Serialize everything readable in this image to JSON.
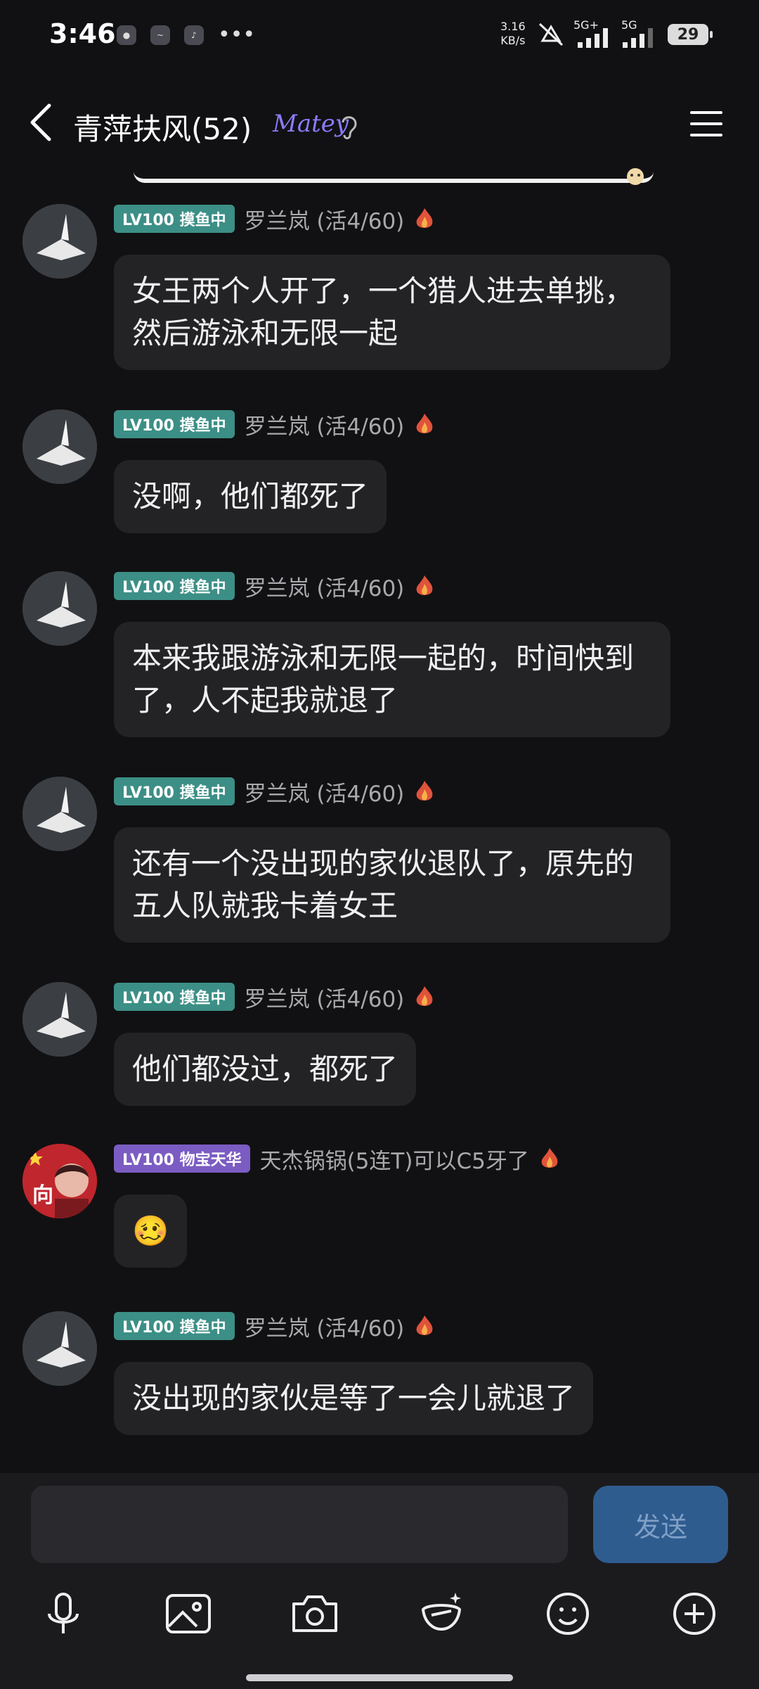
{
  "status_bar": {
    "time": "3:46",
    "net_speed": "3.16",
    "net_unit": "KB/s",
    "sig1": "5G+",
    "sig2": "5G",
    "battery": "29"
  },
  "header": {
    "title": "青萍扶风(52)",
    "badge_text": "Matey"
  },
  "messages": [
    {
      "badge": "LV100 摸鱼中",
      "name": "罗兰岚 (活4/60)",
      "text": "女王两个人开了，一个猎人进去单挑，然后游泳和无限一起"
    },
    {
      "badge": "LV100 摸鱼中",
      "name": "罗兰岚 (活4/60)",
      "text": "没啊，他们都死了"
    },
    {
      "badge": "LV100 摸鱼中",
      "name": "罗兰岚 (活4/60)",
      "text": "本来我跟游泳和无限一起的，时间快到了，人不起我就退了"
    },
    {
      "badge": "LV100 摸鱼中",
      "name": "罗兰岚 (活4/60)",
      "text": "还有一个没出现的家伙退队了，原先的五人队就我卡着女王"
    },
    {
      "badge": "LV100 摸鱼中",
      "name": "罗兰岚 (活4/60)",
      "text": "他们都没过，都死了"
    },
    {
      "badge": "LV100 物宝天华",
      "name": "天杰锅锅(5连T)可以C5牙了",
      "text": "🥴",
      "avatar_text": "向"
    },
    {
      "badge": "LV100 摸鱼中",
      "name": "罗兰岚 (活4/60)",
      "text": "没出现的家伙是等了一会儿就退了"
    }
  ],
  "input": {
    "placeholder": "",
    "send_label": "发送"
  },
  "colors": {
    "badge_green": "#3c8f86",
    "badge_purple": "#7b5cc2",
    "send_bg": "#2f5c8f"
  }
}
